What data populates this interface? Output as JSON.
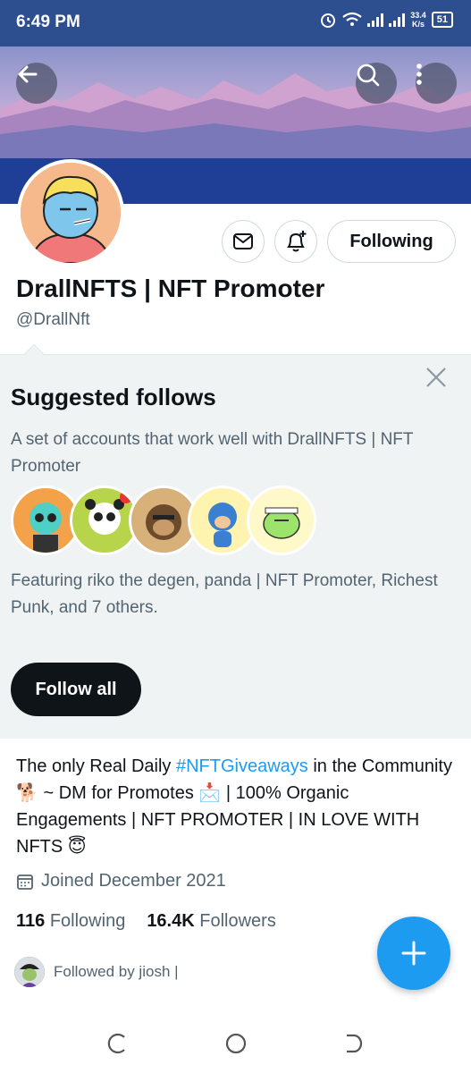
{
  "status_bar": {
    "time": "6:49 PM",
    "net_speed_value": "33.4",
    "net_speed_unit": "K/s",
    "battery": "51"
  },
  "header": {
    "back_icon": "arrow-left-icon",
    "search_icon": "search-icon",
    "more_icon": "more-vertical-icon"
  },
  "profile": {
    "display_name": "DrallNFTS | NFT Promoter",
    "handle": "@DrallNft",
    "following_button": "Following"
  },
  "suggested": {
    "title": "Suggested follows",
    "description": "A set of accounts that work well with DrallNFTS | NFT Promoter",
    "featuring": "Featuring riko the degen, panda | NFT Promoter, Richest Punk, and 7 others.",
    "follow_all": "Follow all"
  },
  "bio": {
    "part1": "The only Real Daily ",
    "hashtag": "#NFTGiveaways",
    "part2": " in the Community 🐕 ~ DM for Promotes 📩 | 100% Organic Engagements | NFT PROMOTER | IN LOVE WITH NFTS 😇"
  },
  "joined": "Joined December 2021",
  "stats": {
    "following_count": "116",
    "following_label": "Following",
    "followers_count": "16.4K",
    "followers_label": "Followers"
  },
  "followed_by": "Followed by jiosh |",
  "colors": {
    "accent": "#1d9bf0",
    "status_bar": "#2e4f8f",
    "suggest_bg": "#f0f3f4"
  }
}
